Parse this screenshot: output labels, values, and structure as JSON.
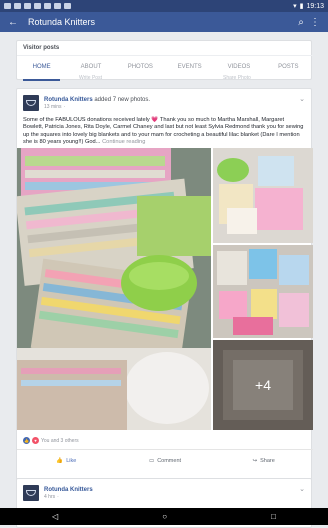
{
  "status": {
    "time": "19:13"
  },
  "appbar": {
    "title": "Rotunda Knitters"
  },
  "page": {
    "visitor_posts": "Visitor posts",
    "tabs": [
      "HOME",
      "ABOUT",
      "PHOTOS",
      "EVENTS",
      "VIDEOS",
      "POSTS"
    ],
    "ghost_left": "Write Post",
    "ghost_right": "Share Photo"
  },
  "post": {
    "author": "Rotunda Knitters",
    "action": "added 7 new photos.",
    "time": "13 mins",
    "text": "Some of the FABULOUS donations received lately 💗 Thank you so much to Martha Marshall, Margaret Bowlett, Patricia Jones, Rita Doyle, Carmel Chaney and last but not least Sylvia Redmond thank you for sewing up the squares into lovely big blankets and to your mam for crocheting a beautiful lilac blanket (Dare I mention she is 80 years young!!) God...",
    "more": "Continue reading",
    "more_photos": "+4",
    "reactions_text": "You and 3 others",
    "actions": {
      "like": "Like",
      "comment": "Comment",
      "share": "Share"
    }
  },
  "post2": {
    "author": "Rotunda Knitters",
    "time": "4 hrs"
  },
  "colors": {
    "brand": "#3b5998",
    "statusbar": "#2d4477"
  }
}
